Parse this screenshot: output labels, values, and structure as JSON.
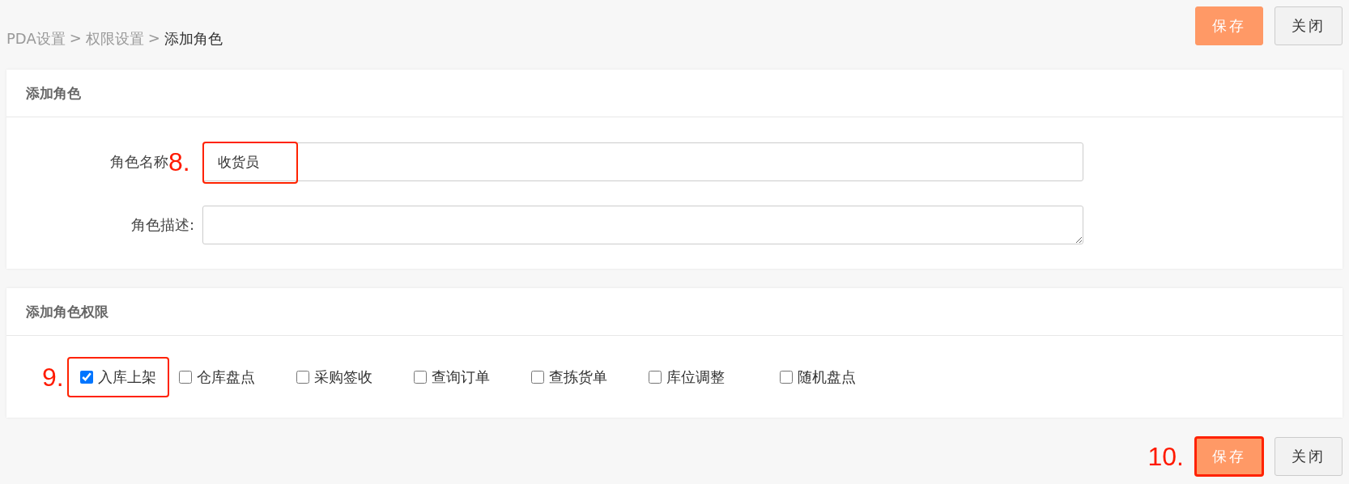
{
  "breadcrumb": [
    {
      "label": "PDA设置",
      "current": false
    },
    {
      "label": "权限设置",
      "current": false
    },
    {
      "label": "添加角色",
      "current": true
    }
  ],
  "breadcrumb_separator": ">",
  "top_buttons": [
    {
      "label": "保存",
      "kind": "primary"
    },
    {
      "label": "关闭",
      "kind": "default"
    }
  ],
  "role_card": {
    "title": "添加角色",
    "fields": [
      {
        "label": "角色名称",
        "kind": "input",
        "value": "收货员",
        "annotation": "8."
      },
      {
        "label": "角色描述:",
        "kind": "textarea"
      }
    ]
  },
  "permission_card": {
    "title": "添加角色权限",
    "permissions": [
      {
        "label": "入库上架",
        "checked": true,
        "annotation": "9."
      },
      {
        "label": "仓库盘点",
        "checked": false
      },
      {
        "label": "采购签收",
        "checked": false
      },
      {
        "label": "查询订单",
        "checked": false
      },
      {
        "label": "查拣货单",
        "checked": false
      },
      {
        "label": "库位调整",
        "checked": false
      },
      {
        "label": "随机盘点",
        "checked": false
      }
    ]
  },
  "bottom_buttons": [
    {
      "label": "保存",
      "kind": "primary",
      "annotation": "10."
    },
    {
      "label": "关闭",
      "kind": "default"
    }
  ]
}
